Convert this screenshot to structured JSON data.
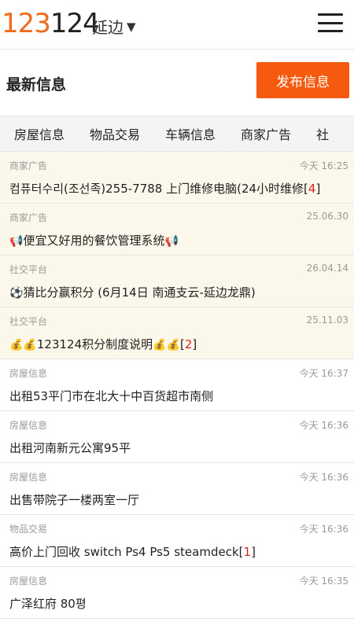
{
  "header": {
    "logo_orange": "123",
    "logo_dark": "124",
    "city": "延边",
    "caret": "▼"
  },
  "section": {
    "title": "最新信息",
    "publish_label": "发布信息"
  },
  "tabs": [
    "房屋信息",
    "物品交易",
    "车辆信息",
    "商家广告",
    "社"
  ],
  "items": [
    {
      "cat": "商家广告",
      "time": "今天 16:25",
      "pre": "",
      "text": "컴퓨터수리(조선족)255-7788  上门维修电脑(24小时维修",
      "post": "",
      "count": "4",
      "pinned": true
    },
    {
      "cat": "商家广告",
      "time": "25.06.30",
      "pre": "📢",
      "text": "便宜又好用的餐饮管理系统",
      "post": "📢",
      "count": "",
      "pinned": true
    },
    {
      "cat": "社交平台",
      "time": "26.04.14",
      "pre": "⚽",
      "text": "猜比分赢积分 (6月14日 南通支云-延边龙鼎)",
      "post": "",
      "count": "",
      "pinned": true
    },
    {
      "cat": "社交平台",
      "time": "25.11.03",
      "pre": "💰💰",
      "text": "123124积分制度说明",
      "post": "💰💰",
      "count": "2",
      "pinned": true
    },
    {
      "cat": "房屋信息",
      "time": "今天 16:37",
      "pre": "",
      "text": "出租53平门市在北大十中百货超市南侧",
      "post": "",
      "count": "",
      "pinned": false
    },
    {
      "cat": "房屋信息",
      "time": "今天 16:36",
      "pre": "",
      "text": "出租河南新元公寓95平",
      "post": "",
      "count": "",
      "pinned": false
    },
    {
      "cat": "房屋信息",
      "time": "今天 16:36",
      "pre": "",
      "text": "出售带院子一楼两室一厅",
      "post": "",
      "count": "",
      "pinned": false
    },
    {
      "cat": "物品交易",
      "time": "今天 16:36",
      "pre": "",
      "text": "高价上门回收 switch Ps4 Ps5 steamdeck",
      "post": "",
      "count": "1",
      "pinned": false
    },
    {
      "cat": "房屋信息",
      "time": "今天 16:35",
      "pre": "",
      "text": "广泽红府  80평",
      "post": "",
      "count": "",
      "pinned": false
    }
  ]
}
